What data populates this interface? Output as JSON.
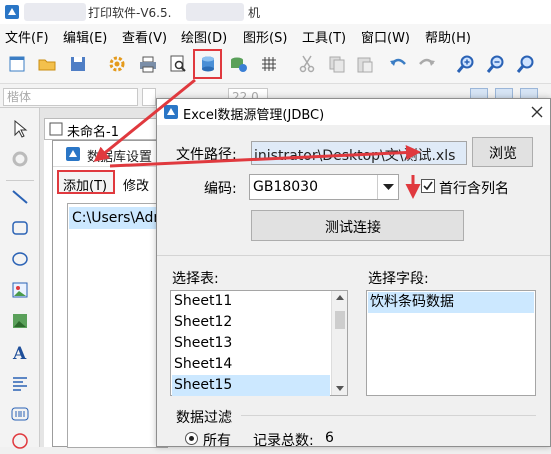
{
  "app": {
    "title_visible": "打印软件-V6.5.",
    "title_suffix": "机"
  },
  "menu": [
    "文件(F)",
    "编辑(E)",
    "查看(V)",
    "绘图(D)",
    "图形(S)",
    "工具(T)",
    "窗口(W)",
    "帮助(H)"
  ],
  "toolbar2": {
    "font_name": "楷体",
    "font_size": "22.0"
  },
  "document_tab": {
    "label": "未命名-1"
  },
  "db_settings": {
    "title": "数据库设置",
    "add_button": "添加(T)",
    "edit_button": "修改",
    "list": [
      "C:\\Users\\Adm"
    ]
  },
  "excel_dialog": {
    "title": "Excel数据源管理(JDBC)",
    "file_path_label": "文件路径:",
    "file_path_value": "inistrator\\Desktop\\文\\测试.xls",
    "browse_button": "浏览",
    "encoding_label": "编码:",
    "encoding_value": "GB18030",
    "first_row_label": "首行含列名",
    "first_row_checked": true,
    "test_button": "测试连接",
    "select_table_label": "选择表:",
    "tables": [
      "Sheet11",
      "Sheet12",
      "Sheet13",
      "Sheet14",
      "Sheet15"
    ],
    "selected_table": "Sheet15",
    "select_field_label": "选择字段:",
    "fields": [
      "饮料条码数据"
    ],
    "filter_group_label": "数据过滤",
    "filter_all_label": "所有",
    "record_count_label": "记录总数:",
    "record_count_value": "6"
  },
  "colors": {
    "highlight": "#e0393e",
    "selection": "#cce8ff",
    "arrow": "#e0393e"
  }
}
